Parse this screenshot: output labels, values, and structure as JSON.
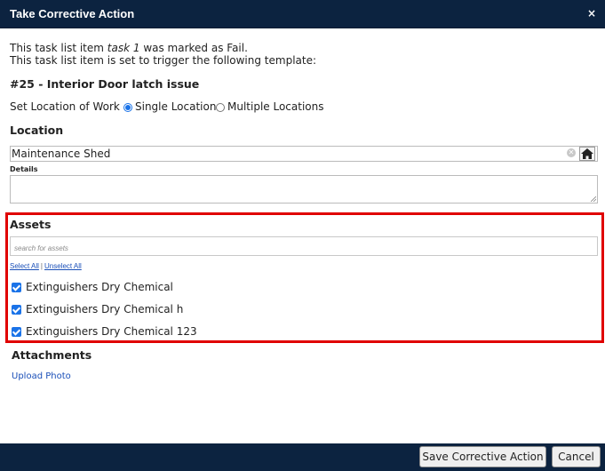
{
  "dialog": {
    "title": "Take Corrective Action",
    "close_glyph": "×"
  },
  "intro": {
    "line1_prefix": "This task list item ",
    "line1_item": "task 1",
    "line1_suffix": " was marked as Fail.",
    "line2": "This task list item is set to trigger the following template:"
  },
  "template_title": "#25 - Interior Door latch issue",
  "set_location": {
    "label": "Set Location of Work",
    "options": [
      {
        "label": "Single Location",
        "checked": true
      },
      {
        "label": "Multiple Locations",
        "checked": false
      }
    ]
  },
  "location": {
    "heading": "Location",
    "value": "Maintenance Shed",
    "clear_icon": "clear-icon",
    "home_icon": "home-icon"
  },
  "details": {
    "label": "Details",
    "value": ""
  },
  "assets": {
    "heading": "Assets",
    "search_placeholder": "search for assets",
    "select_all": "Select All",
    "separator": "|",
    "unselect_all": "Unselect All",
    "items": [
      {
        "label": "Extinguishers Dry Chemical",
        "checked": true
      },
      {
        "label": "Extinguishers Dry Chemical h",
        "checked": true
      },
      {
        "label": "Extinguishers Dry Chemical 123",
        "checked": true
      }
    ],
    "highlight_color": "#e00000"
  },
  "attachments": {
    "heading": "Attachments",
    "upload_label": "Upload Photo"
  },
  "footer": {
    "save_label": "Save Corrective Action",
    "cancel_label": "Cancel"
  },
  "colors": {
    "header_bg": "#0c2340",
    "accent": "#1a73e8",
    "link": "#1a4fb8"
  }
}
